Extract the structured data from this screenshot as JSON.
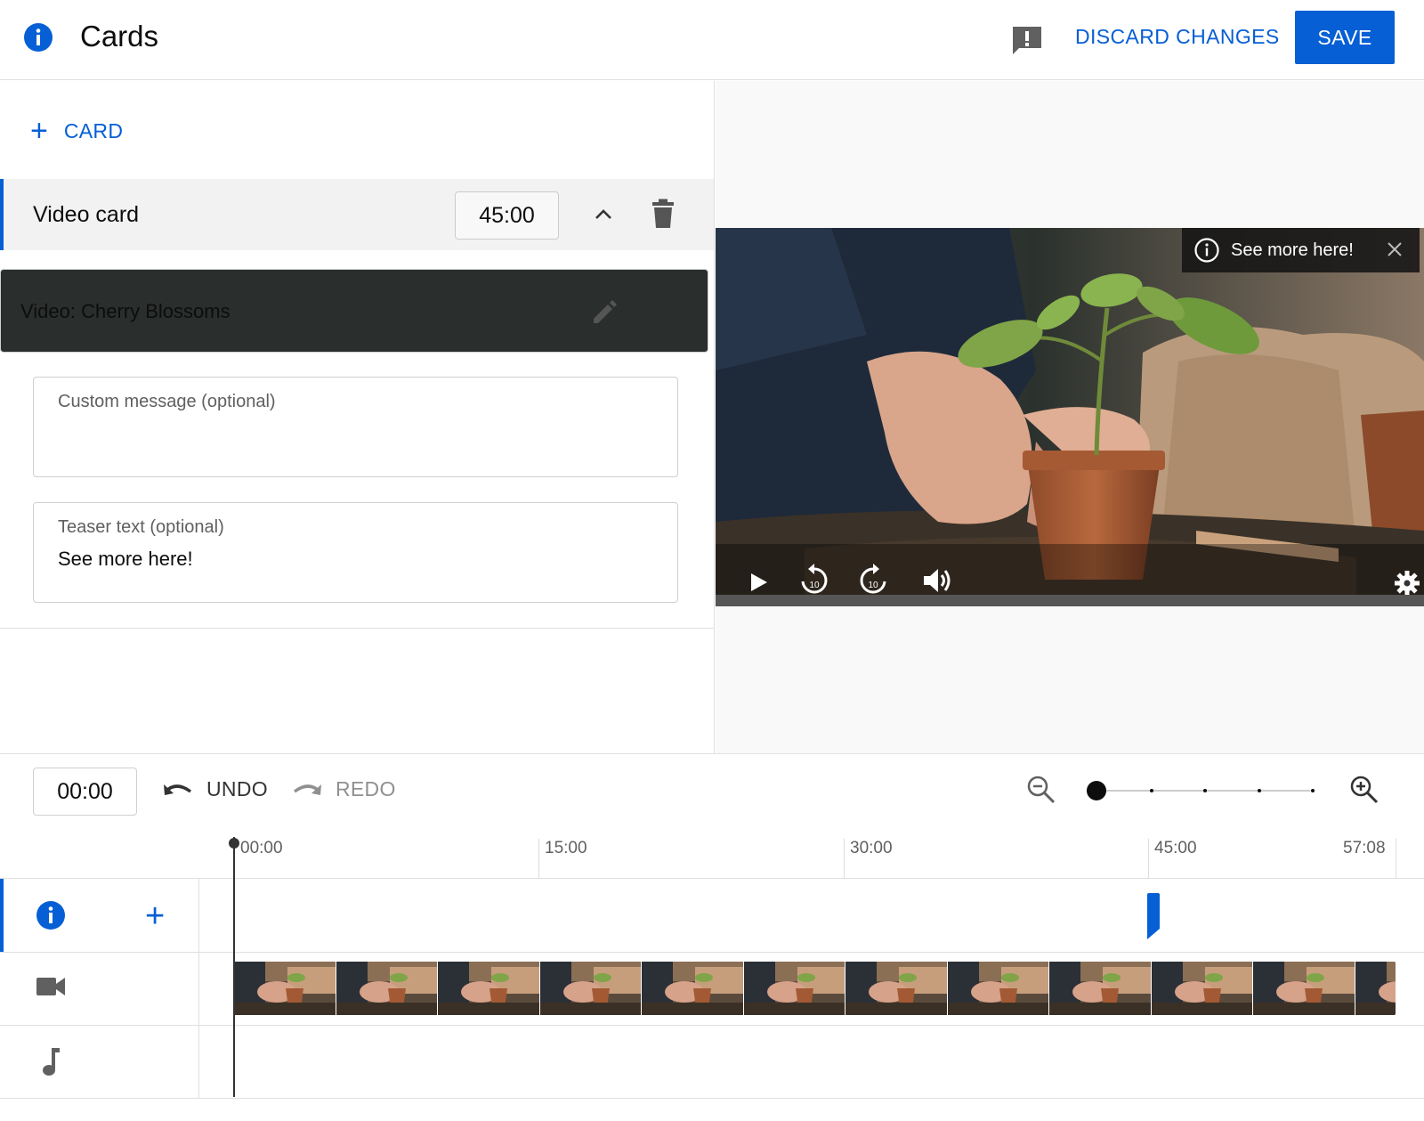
{
  "header": {
    "title": "Cards",
    "discard_label": "DISCARD CHANGES",
    "save_label": "SAVE"
  },
  "editor": {
    "add_card_label": "CARD",
    "card": {
      "name": "Video card",
      "time": "45:00"
    },
    "video_field": {
      "value": "Video: Cherry Blossoms"
    },
    "custom_message": {
      "label": "Custom message (optional)",
      "value": ""
    },
    "teaser_text": {
      "label": "Teaser text (optional)",
      "value": "See more here!"
    }
  },
  "preview": {
    "teaser_popup": "See more here!",
    "rewind_label": "10",
    "forward_label": "10"
  },
  "timeline_controls": {
    "timecode": "00:00",
    "undo_label": "UNDO",
    "redo_label": "REDO",
    "zoom_level_index": 0,
    "zoom_levels": 5
  },
  "timeline": {
    "ticks": [
      "00:00",
      "15:00",
      "30:00",
      "45:00",
      "57:08"
    ],
    "card_marker_time": "45:00",
    "duration": "57:08"
  },
  "colors": {
    "accent": "#065fd4",
    "text": "#0d0d0d",
    "muted": "#606060"
  },
  "icons": {
    "header": "info-icon",
    "feedback": "feedback-icon",
    "collapse": "chevron-up-icon",
    "delete": "trash-icon",
    "edit": "pencil-icon",
    "play": "play-icon",
    "volume": "volume-icon",
    "settings": "gear-icon",
    "video_track": "videocam-icon",
    "audio_track": "music-note-icon"
  }
}
